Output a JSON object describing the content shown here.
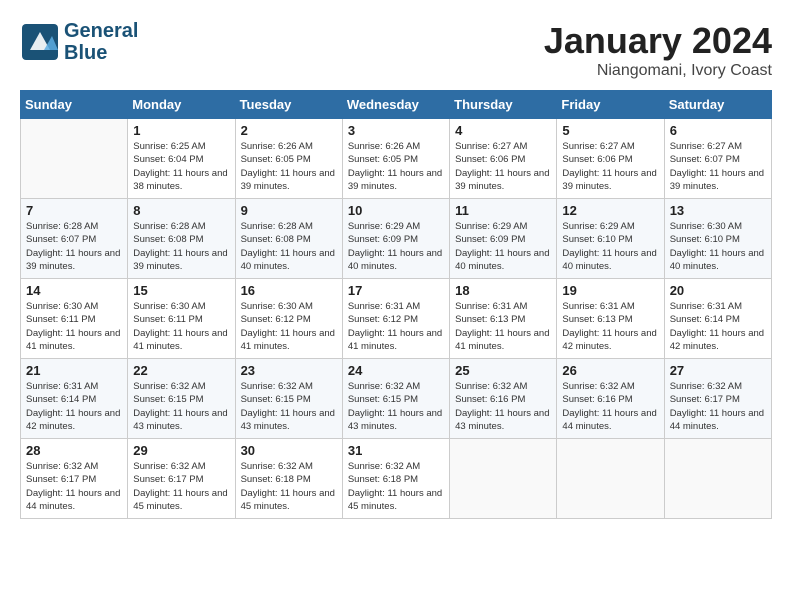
{
  "header": {
    "logo_line1": "General",
    "logo_line2": "Blue",
    "month": "January 2024",
    "location": "Niangomani, Ivory Coast"
  },
  "days_of_week": [
    "Sunday",
    "Monday",
    "Tuesday",
    "Wednesday",
    "Thursday",
    "Friday",
    "Saturday"
  ],
  "weeks": [
    [
      {
        "day": "",
        "sunrise": "",
        "sunset": "",
        "daylight": ""
      },
      {
        "day": "1",
        "sunrise": "Sunrise: 6:25 AM",
        "sunset": "Sunset: 6:04 PM",
        "daylight": "Daylight: 11 hours and 38 minutes."
      },
      {
        "day": "2",
        "sunrise": "Sunrise: 6:26 AM",
        "sunset": "Sunset: 6:05 PM",
        "daylight": "Daylight: 11 hours and 39 minutes."
      },
      {
        "day": "3",
        "sunrise": "Sunrise: 6:26 AM",
        "sunset": "Sunset: 6:05 PM",
        "daylight": "Daylight: 11 hours and 39 minutes."
      },
      {
        "day": "4",
        "sunrise": "Sunrise: 6:27 AM",
        "sunset": "Sunset: 6:06 PM",
        "daylight": "Daylight: 11 hours and 39 minutes."
      },
      {
        "day": "5",
        "sunrise": "Sunrise: 6:27 AM",
        "sunset": "Sunset: 6:06 PM",
        "daylight": "Daylight: 11 hours and 39 minutes."
      },
      {
        "day": "6",
        "sunrise": "Sunrise: 6:27 AM",
        "sunset": "Sunset: 6:07 PM",
        "daylight": "Daylight: 11 hours and 39 minutes."
      }
    ],
    [
      {
        "day": "7",
        "sunrise": "Sunrise: 6:28 AM",
        "sunset": "Sunset: 6:07 PM",
        "daylight": "Daylight: 11 hours and 39 minutes."
      },
      {
        "day": "8",
        "sunrise": "Sunrise: 6:28 AM",
        "sunset": "Sunset: 6:08 PM",
        "daylight": "Daylight: 11 hours and 39 minutes."
      },
      {
        "day": "9",
        "sunrise": "Sunrise: 6:28 AM",
        "sunset": "Sunset: 6:08 PM",
        "daylight": "Daylight: 11 hours and 40 minutes."
      },
      {
        "day": "10",
        "sunrise": "Sunrise: 6:29 AM",
        "sunset": "Sunset: 6:09 PM",
        "daylight": "Daylight: 11 hours and 40 minutes."
      },
      {
        "day": "11",
        "sunrise": "Sunrise: 6:29 AM",
        "sunset": "Sunset: 6:09 PM",
        "daylight": "Daylight: 11 hours and 40 minutes."
      },
      {
        "day": "12",
        "sunrise": "Sunrise: 6:29 AM",
        "sunset": "Sunset: 6:10 PM",
        "daylight": "Daylight: 11 hours and 40 minutes."
      },
      {
        "day": "13",
        "sunrise": "Sunrise: 6:30 AM",
        "sunset": "Sunset: 6:10 PM",
        "daylight": "Daylight: 11 hours and 40 minutes."
      }
    ],
    [
      {
        "day": "14",
        "sunrise": "Sunrise: 6:30 AM",
        "sunset": "Sunset: 6:11 PM",
        "daylight": "Daylight: 11 hours and 41 minutes."
      },
      {
        "day": "15",
        "sunrise": "Sunrise: 6:30 AM",
        "sunset": "Sunset: 6:11 PM",
        "daylight": "Daylight: 11 hours and 41 minutes."
      },
      {
        "day": "16",
        "sunrise": "Sunrise: 6:30 AM",
        "sunset": "Sunset: 6:12 PM",
        "daylight": "Daylight: 11 hours and 41 minutes."
      },
      {
        "day": "17",
        "sunrise": "Sunrise: 6:31 AM",
        "sunset": "Sunset: 6:12 PM",
        "daylight": "Daylight: 11 hours and 41 minutes."
      },
      {
        "day": "18",
        "sunrise": "Sunrise: 6:31 AM",
        "sunset": "Sunset: 6:13 PM",
        "daylight": "Daylight: 11 hours and 41 minutes."
      },
      {
        "day": "19",
        "sunrise": "Sunrise: 6:31 AM",
        "sunset": "Sunset: 6:13 PM",
        "daylight": "Daylight: 11 hours and 42 minutes."
      },
      {
        "day": "20",
        "sunrise": "Sunrise: 6:31 AM",
        "sunset": "Sunset: 6:14 PM",
        "daylight": "Daylight: 11 hours and 42 minutes."
      }
    ],
    [
      {
        "day": "21",
        "sunrise": "Sunrise: 6:31 AM",
        "sunset": "Sunset: 6:14 PM",
        "daylight": "Daylight: 11 hours and 42 minutes."
      },
      {
        "day": "22",
        "sunrise": "Sunrise: 6:32 AM",
        "sunset": "Sunset: 6:15 PM",
        "daylight": "Daylight: 11 hours and 43 minutes."
      },
      {
        "day": "23",
        "sunrise": "Sunrise: 6:32 AM",
        "sunset": "Sunset: 6:15 PM",
        "daylight": "Daylight: 11 hours and 43 minutes."
      },
      {
        "day": "24",
        "sunrise": "Sunrise: 6:32 AM",
        "sunset": "Sunset: 6:15 PM",
        "daylight": "Daylight: 11 hours and 43 minutes."
      },
      {
        "day": "25",
        "sunrise": "Sunrise: 6:32 AM",
        "sunset": "Sunset: 6:16 PM",
        "daylight": "Daylight: 11 hours and 43 minutes."
      },
      {
        "day": "26",
        "sunrise": "Sunrise: 6:32 AM",
        "sunset": "Sunset: 6:16 PM",
        "daylight": "Daylight: 11 hours and 44 minutes."
      },
      {
        "day": "27",
        "sunrise": "Sunrise: 6:32 AM",
        "sunset": "Sunset: 6:17 PM",
        "daylight": "Daylight: 11 hours and 44 minutes."
      }
    ],
    [
      {
        "day": "28",
        "sunrise": "Sunrise: 6:32 AM",
        "sunset": "Sunset: 6:17 PM",
        "daylight": "Daylight: 11 hours and 44 minutes."
      },
      {
        "day": "29",
        "sunrise": "Sunrise: 6:32 AM",
        "sunset": "Sunset: 6:17 PM",
        "daylight": "Daylight: 11 hours and 45 minutes."
      },
      {
        "day": "30",
        "sunrise": "Sunrise: 6:32 AM",
        "sunset": "Sunset: 6:18 PM",
        "daylight": "Daylight: 11 hours and 45 minutes."
      },
      {
        "day": "31",
        "sunrise": "Sunrise: 6:32 AM",
        "sunset": "Sunset: 6:18 PM",
        "daylight": "Daylight: 11 hours and 45 minutes."
      },
      {
        "day": "",
        "sunrise": "",
        "sunset": "",
        "daylight": ""
      },
      {
        "day": "",
        "sunrise": "",
        "sunset": "",
        "daylight": ""
      },
      {
        "day": "",
        "sunrise": "",
        "sunset": "",
        "daylight": ""
      }
    ]
  ]
}
